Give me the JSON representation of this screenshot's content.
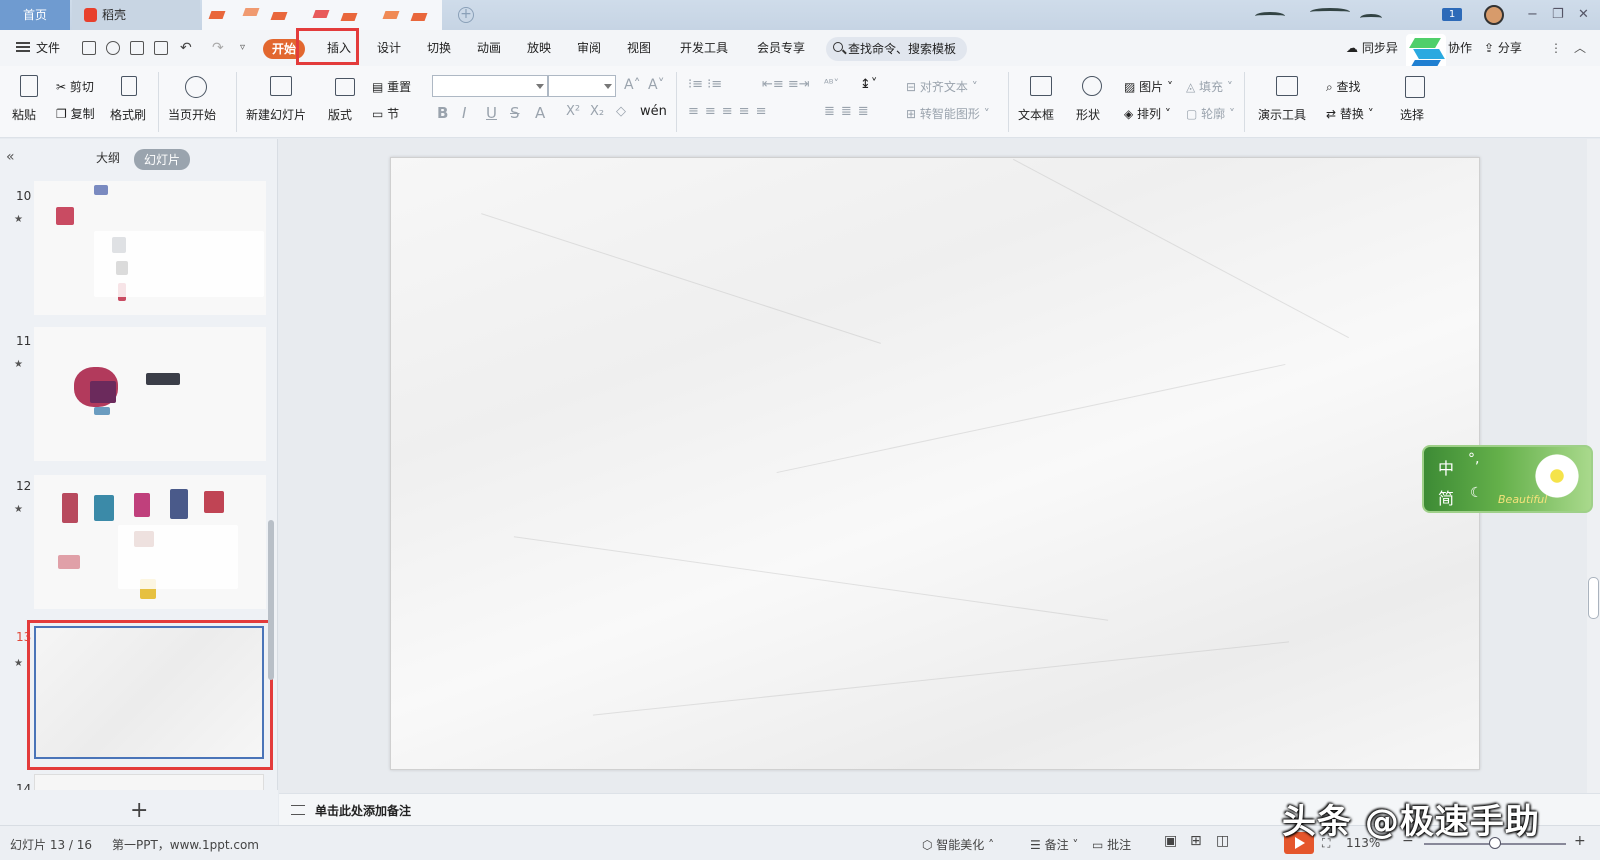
{
  "titlebar": {
    "tabs": {
      "home": "首页",
      "daoke": "稻壳"
    },
    "badge": "1",
    "minimize": "−",
    "restore": "❐",
    "close": "✕"
  },
  "ribbon_tabs": {
    "file": "文件",
    "items": [
      "开始",
      "插入",
      "设计",
      "切换",
      "动画",
      "放映",
      "审阅",
      "视图",
      "开发工具",
      "会员专享"
    ],
    "search": "查找命令、搜索模板",
    "right": {
      "sync": "同步异",
      "collab": "协作",
      "share": "分享"
    }
  },
  "toolbar": {
    "paste": "粘贴",
    "cut": "剪切",
    "copy": "复制",
    "format_painter": "格式刷",
    "from_current": "当页开始",
    "new_slide": "新建幻灯片",
    "layout": "版式",
    "reset": "重置",
    "section": "节",
    "align_text": "对齐文本",
    "smart_art": "转智能图形",
    "text_box": "文本框",
    "shape": "形状",
    "picture": "图片",
    "arrange": "排列",
    "fill": "填充",
    "outline": "轮廓",
    "present_tool": "演示工具",
    "find": "查找",
    "replace": "替换",
    "select": "选择"
  },
  "left_panel": {
    "tab_outline": "大纲",
    "tab_slides": "幻灯片",
    "slide_numbers": [
      "10",
      "11",
      "12",
      "13",
      "14"
    ],
    "star": "★"
  },
  "ime": {
    "mode1": "中",
    "mode2": "简",
    "punct": "°,",
    "moon": "☾",
    "brand": "Beautiful"
  },
  "notes": {
    "placeholder": "单击此处添加备注"
  },
  "status": {
    "slide_count": "幻灯片 13 / 16",
    "theme": "第一PPT，www.1ppt.com",
    "beautify": "智能美化",
    "notes": "备注",
    "comments": "批注",
    "zoom": "113%"
  },
  "watermark": "头条 @极速手助"
}
